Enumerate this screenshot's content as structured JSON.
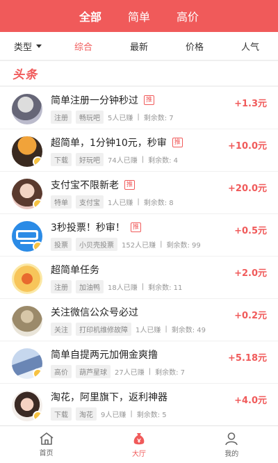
{
  "top_tabs": [
    "全部",
    "简单",
    "高价"
  ],
  "sort": {
    "type_label": "类型",
    "items": [
      "综合",
      "最新",
      "价格",
      "人气"
    ]
  },
  "section_title": "头条",
  "mark_text": "推",
  "tasks": [
    {
      "title": "简单注册一分钟秒过",
      "tags": [
        "注册",
        "畅玩吧"
      ],
      "earned": "5人已赚",
      "remaining": "剩余数: 7",
      "reward": "+1.3元"
    },
    {
      "title": "超简单，1分钟10元，秒审",
      "tags": [
        "下载",
        "好玩吧"
      ],
      "earned": "74人已赚",
      "remaining": "剩余数: 4",
      "reward": "+10.0元"
    },
    {
      "title": "支付宝不限新老",
      "tags": [
        "特单",
        "支付宝"
      ],
      "earned": "1人已赚",
      "remaining": "剩余数: 8",
      "reward": "+20.0元"
    },
    {
      "title": "3秒投票！秒审！",
      "tags": [
        "投票",
        "小贝壳投票"
      ],
      "earned": "152人已赚",
      "remaining": "剩余数: 99",
      "reward": "+0.5元"
    },
    {
      "title": "超简单任务",
      "tags": [
        "注册",
        "加油鸭"
      ],
      "earned": "18人已赚",
      "remaining": "剩余数: 11",
      "reward": "+2.0元"
    },
    {
      "title": "关注微信公众号必过",
      "tags": [
        "关注",
        "打印机维修故障"
      ],
      "earned": "1人已赚",
      "remaining": "剩余数: 49",
      "reward": "+0.2元"
    },
    {
      "title": "简单自提两元加佣金爽撸",
      "tags": [
        "高价",
        "葫芦星球"
      ],
      "earned": "27人已赚",
      "remaining": "剩余数: 7",
      "reward": "+5.18元"
    },
    {
      "title": "淘花，阿里旗下，返利神器",
      "tags": [
        "下载",
        "淘花"
      ],
      "earned": "9人已赚",
      "remaining": "剩余数: 5",
      "reward": "+4.0元"
    }
  ],
  "bottom_nav": [
    {
      "label": "首页",
      "icon": "home-icon"
    },
    {
      "label": "大厅",
      "icon": "moneybag-icon"
    },
    {
      "label": "我的",
      "icon": "person-icon"
    }
  ],
  "colors": {
    "accent": "#f05a5a",
    "badge": "#f6c243"
  }
}
